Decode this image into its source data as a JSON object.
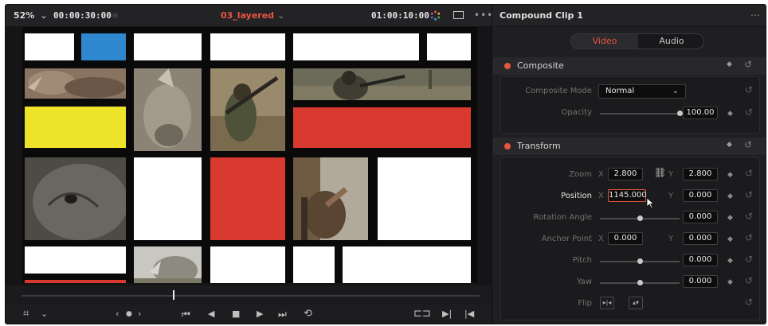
{
  "viewer": {
    "zoom_level": "52%",
    "source_timecode": "00:00:30:00",
    "clip_name": "03_layered",
    "record_timecode": "01:00:10:00",
    "scrub_position": 0.33
  },
  "inspector": {
    "title": "Compound Clip 1",
    "tabs": [
      {
        "label": "Video",
        "active": true
      },
      {
        "label": "Audio",
        "active": false
      }
    ],
    "composite": {
      "title": "Composite",
      "mode_label": "Composite Mode",
      "mode_value": "Normal",
      "opacity_label": "Opacity",
      "opacity_value": "100.00",
      "opacity_fraction": 1.0
    },
    "transform": {
      "title": "Transform",
      "zoom": {
        "label": "Zoom",
        "x_axis": "X",
        "x": "2.800",
        "y_axis": "Y",
        "y": "2.800"
      },
      "position": {
        "label": "Position",
        "x_axis": "X",
        "x": "1145.000",
        "y_axis": "Y",
        "y": "0.000"
      },
      "rotation": {
        "label": "Rotation Angle",
        "value": "0.000",
        "fraction": 0.5
      },
      "anchor": {
        "label": "Anchor Point",
        "x_axis": "X",
        "x": "0.000",
        "y_axis": "Y",
        "y": "0.000"
      },
      "pitch": {
        "label": "Pitch",
        "value": "0.000",
        "fraction": 0.5
      },
      "yaw": {
        "label": "Yaw",
        "value": "0.000",
        "fraction": 0.5
      },
      "flip": {
        "label": "Flip"
      }
    }
  },
  "colors": {
    "accent": "#e8553f",
    "panel_bg": "#1f1f22",
    "mondrian_red": "#d83a30",
    "mondrian_yellow": "#ede42a",
    "mondrian_blue": "#2e87cf"
  },
  "icons": {
    "viewer": [
      "chevron-down-icon",
      "color-wheel-icon",
      "monitor-icon",
      "more-options-icon"
    ],
    "transport": [
      "transform-overlay-icon",
      "chevron-down-icon",
      "prev-edit-icon",
      "next-edit-icon",
      "jump-to-start-icon",
      "play-reverse-icon",
      "stop-icon",
      "play-icon",
      "jump-to-end-icon",
      "loop-icon",
      "match-frame-icon",
      "mark-in-icon",
      "mark-out-icon"
    ],
    "inspector": [
      "keyframe-diamond-icon",
      "reset-icon",
      "link-icon",
      "flip-horizontal-icon",
      "flip-vertical-icon"
    ]
  }
}
